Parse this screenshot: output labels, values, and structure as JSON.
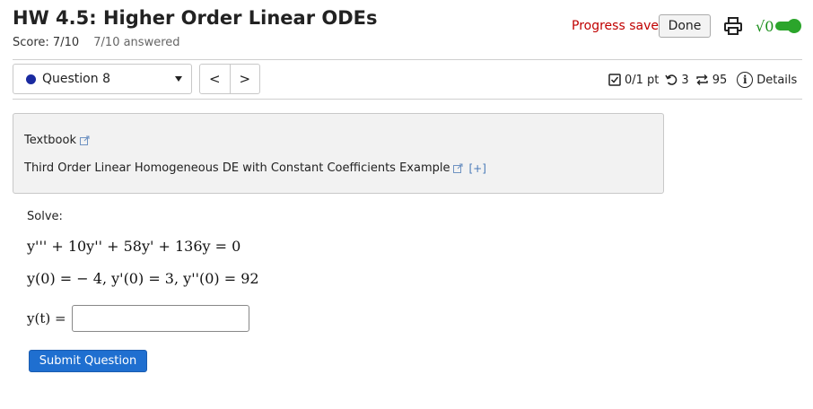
{
  "header": {
    "title": "HW 4.5: Higher Order Linear ODEs",
    "score_label": "Score: 7/10",
    "answered_label": "7/10 answered",
    "progress_saved": "Progress saved",
    "done_label": "Done",
    "print_icon": "print-icon",
    "math_toggle_icon": "square-root-toggle-icon",
    "sqrt_symbol": "√0"
  },
  "question_nav": {
    "selected_question": "Question 8",
    "status_color": "#1a2aa0",
    "prev_label": "<",
    "next_label": ">"
  },
  "meta": {
    "points": "0/1 pt",
    "retries": "3",
    "attempts": "95",
    "details_label": "Details",
    "info_symbol": "i"
  },
  "info_box": {
    "textbook_label": "Textbook",
    "example_label": "Third Order Linear Homogeneous DE with Constant Coefficients Example",
    "expand_label": "[+]"
  },
  "problem": {
    "instruction": "Solve:",
    "equation": "y''' + 10y'' + 58y' + 136y = 0",
    "initial_conditions": "y(0) = − 4,  y'(0) = 3,  y''(0) = 92",
    "answer_label": "y(t) =",
    "answer_value": "",
    "answer_placeholder": ""
  },
  "actions": {
    "submit_label": "Submit Question",
    "submit_color": "#1f6fd0"
  }
}
